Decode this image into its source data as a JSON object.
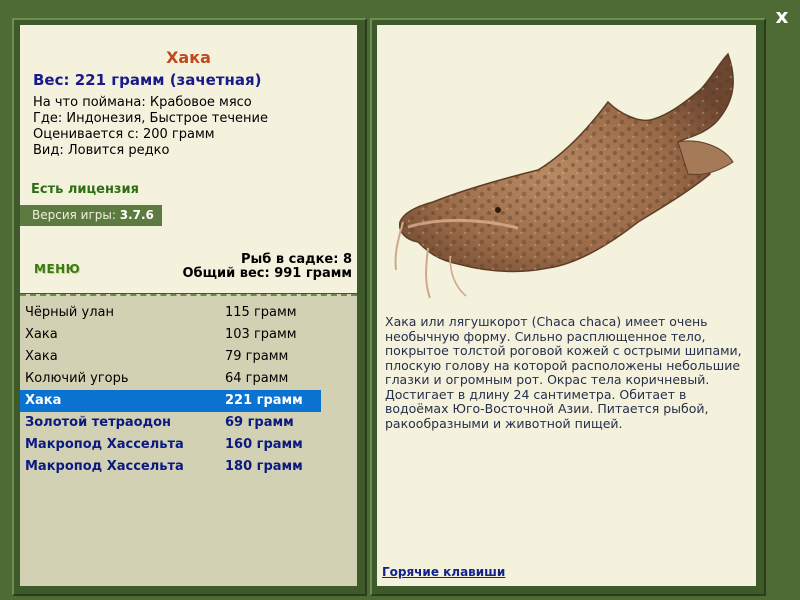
{
  "window": {
    "close_label": "x"
  },
  "fish": {
    "name": "Хака",
    "weight": "Вес: 221 грамм (зачетная)",
    "details": [
      "На что поймана: Крабовое мясо",
      "Где: Индонезия, Быстрое течение",
      "Оценивается с: 200 грамм",
      "Вид: Ловится редко"
    ],
    "description": "Хака или лягушкорот (Chaca chaca) имеет очень необычную форму. Сильно расплющенное тело, покрытое толстой роговой кожей с острыми шипами, плоскую голову на которой расположены небольшие глазки и огромным рот. Окрас тела коричневый. Достигает в длину 24 сантиметра. Обитает в водоёмах Юго-Восточной Азии. Питается рыбой, ракообразными и животной пищей."
  },
  "license": "Есть лицензия",
  "version": {
    "label": "Версия игры:",
    "value": "3.7.6"
  },
  "menu_label": "МЕНЮ",
  "cage": {
    "count_label": "Рыб в садке: 8",
    "total_label": "Общий вес: 991 грамм"
  },
  "catch_list": [
    {
      "name": "Чёрный улан",
      "weight": "115 грамм",
      "style": "normal"
    },
    {
      "name": "Хака",
      "weight": "103 грамм",
      "style": "normal"
    },
    {
      "name": "Хака",
      "weight": "79 грамм",
      "style": "normal"
    },
    {
      "name": "Колючий угорь",
      "weight": "64 грамм",
      "style": "normal"
    },
    {
      "name": "Хака",
      "weight": "221 грамм",
      "style": "selected"
    },
    {
      "name": "Золотой тетраодон",
      "weight": "69 грамм",
      "style": "bold"
    },
    {
      "name": "Макропод Хассельта",
      "weight": "160 грамм",
      "style": "bold"
    },
    {
      "name": "Макропод Хассельта",
      "weight": "180 грамм",
      "style": "bold"
    }
  ],
  "hotkeys_label": "Горячие клавиши",
  "colors": {
    "background": "#4e6a35",
    "panel": "#f4f1dc",
    "list_panel": "#d3d1b3",
    "selection": "#0a72d1",
    "title": "#c0481c",
    "weight": "#1a1a8c"
  }
}
